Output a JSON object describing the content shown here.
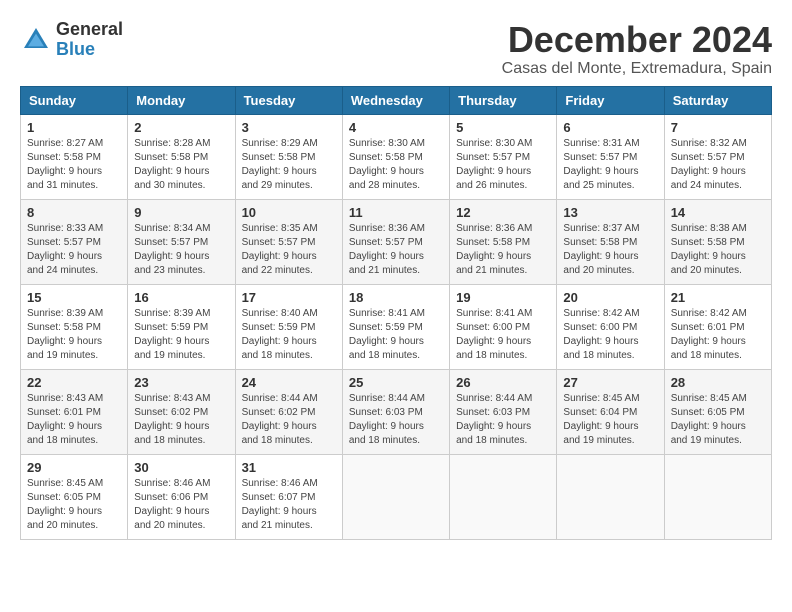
{
  "header": {
    "logo_general": "General",
    "logo_blue": "Blue",
    "month_title": "December 2024",
    "location": "Casas del Monte, Extremadura, Spain"
  },
  "columns": [
    "Sunday",
    "Monday",
    "Tuesday",
    "Wednesday",
    "Thursday",
    "Friday",
    "Saturday"
  ],
  "weeks": [
    [
      {
        "day": "1",
        "sunrise": "8:27 AM",
        "sunset": "5:58 PM",
        "daylight": "9 hours and 31 minutes."
      },
      {
        "day": "2",
        "sunrise": "8:28 AM",
        "sunset": "5:58 PM",
        "daylight": "9 hours and 30 minutes."
      },
      {
        "day": "3",
        "sunrise": "8:29 AM",
        "sunset": "5:58 PM",
        "daylight": "9 hours and 29 minutes."
      },
      {
        "day": "4",
        "sunrise": "8:30 AM",
        "sunset": "5:58 PM",
        "daylight": "9 hours and 28 minutes."
      },
      {
        "day": "5",
        "sunrise": "8:30 AM",
        "sunset": "5:57 PM",
        "daylight": "9 hours and 26 minutes."
      },
      {
        "day": "6",
        "sunrise": "8:31 AM",
        "sunset": "5:57 PM",
        "daylight": "9 hours and 25 minutes."
      },
      {
        "day": "7",
        "sunrise": "8:32 AM",
        "sunset": "5:57 PM",
        "daylight": "9 hours and 24 minutes."
      }
    ],
    [
      {
        "day": "8",
        "sunrise": "8:33 AM",
        "sunset": "5:57 PM",
        "daylight": "9 hours and 24 minutes."
      },
      {
        "day": "9",
        "sunrise": "8:34 AM",
        "sunset": "5:57 PM",
        "daylight": "9 hours and 23 minutes."
      },
      {
        "day": "10",
        "sunrise": "8:35 AM",
        "sunset": "5:57 PM",
        "daylight": "9 hours and 22 minutes."
      },
      {
        "day": "11",
        "sunrise": "8:36 AM",
        "sunset": "5:57 PM",
        "daylight": "9 hours and 21 minutes."
      },
      {
        "day": "12",
        "sunrise": "8:36 AM",
        "sunset": "5:58 PM",
        "daylight": "9 hours and 21 minutes."
      },
      {
        "day": "13",
        "sunrise": "8:37 AM",
        "sunset": "5:58 PM",
        "daylight": "9 hours and 20 minutes."
      },
      {
        "day": "14",
        "sunrise": "8:38 AM",
        "sunset": "5:58 PM",
        "daylight": "9 hours and 20 minutes."
      }
    ],
    [
      {
        "day": "15",
        "sunrise": "8:39 AM",
        "sunset": "5:58 PM",
        "daylight": "9 hours and 19 minutes."
      },
      {
        "day": "16",
        "sunrise": "8:39 AM",
        "sunset": "5:59 PM",
        "daylight": "9 hours and 19 minutes."
      },
      {
        "day": "17",
        "sunrise": "8:40 AM",
        "sunset": "5:59 PM",
        "daylight": "9 hours and 18 minutes."
      },
      {
        "day": "18",
        "sunrise": "8:41 AM",
        "sunset": "5:59 PM",
        "daylight": "9 hours and 18 minutes."
      },
      {
        "day": "19",
        "sunrise": "8:41 AM",
        "sunset": "6:00 PM",
        "daylight": "9 hours and 18 minutes."
      },
      {
        "day": "20",
        "sunrise": "8:42 AM",
        "sunset": "6:00 PM",
        "daylight": "9 hours and 18 minutes."
      },
      {
        "day": "21",
        "sunrise": "8:42 AM",
        "sunset": "6:01 PM",
        "daylight": "9 hours and 18 minutes."
      }
    ],
    [
      {
        "day": "22",
        "sunrise": "8:43 AM",
        "sunset": "6:01 PM",
        "daylight": "9 hours and 18 minutes."
      },
      {
        "day": "23",
        "sunrise": "8:43 AM",
        "sunset": "6:02 PM",
        "daylight": "9 hours and 18 minutes."
      },
      {
        "day": "24",
        "sunrise": "8:44 AM",
        "sunset": "6:02 PM",
        "daylight": "9 hours and 18 minutes."
      },
      {
        "day": "25",
        "sunrise": "8:44 AM",
        "sunset": "6:03 PM",
        "daylight": "9 hours and 18 minutes."
      },
      {
        "day": "26",
        "sunrise": "8:44 AM",
        "sunset": "6:03 PM",
        "daylight": "9 hours and 18 minutes."
      },
      {
        "day": "27",
        "sunrise": "8:45 AM",
        "sunset": "6:04 PM",
        "daylight": "9 hours and 19 minutes."
      },
      {
        "day": "28",
        "sunrise": "8:45 AM",
        "sunset": "6:05 PM",
        "daylight": "9 hours and 19 minutes."
      }
    ],
    [
      {
        "day": "29",
        "sunrise": "8:45 AM",
        "sunset": "6:05 PM",
        "daylight": "9 hours and 20 minutes."
      },
      {
        "day": "30",
        "sunrise": "8:46 AM",
        "sunset": "6:06 PM",
        "daylight": "9 hours and 20 minutes."
      },
      {
        "day": "31",
        "sunrise": "8:46 AM",
        "sunset": "6:07 PM",
        "daylight": "9 hours and 21 minutes."
      },
      null,
      null,
      null,
      null
    ]
  ]
}
